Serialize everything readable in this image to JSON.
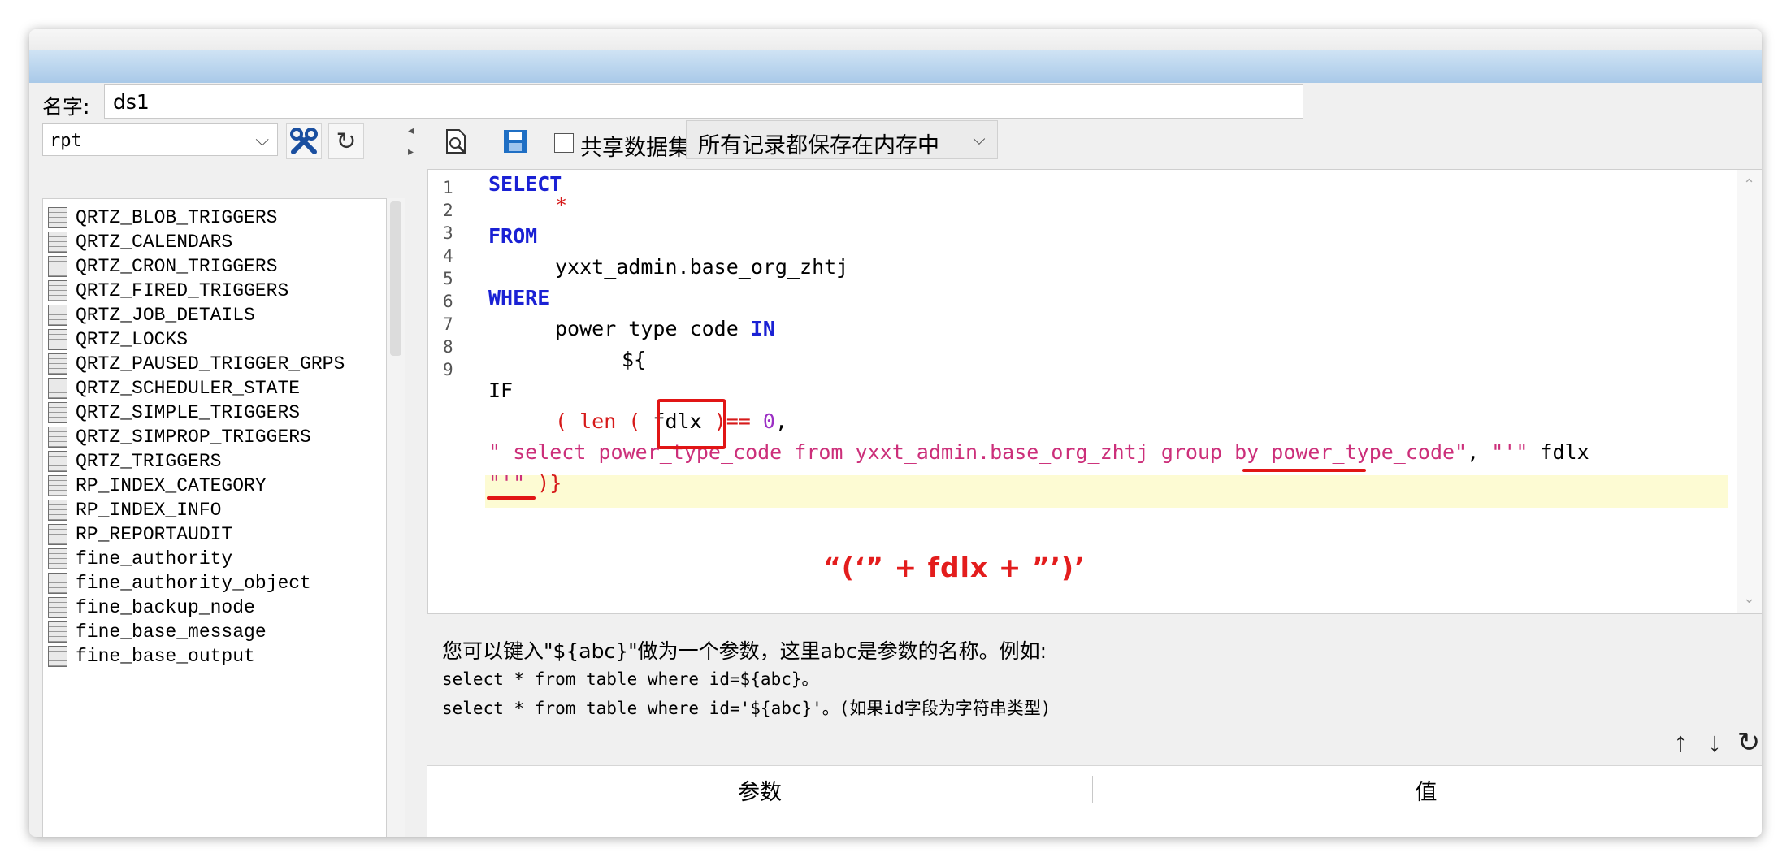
{
  "dataset": {
    "name_label": "名字:",
    "name_value": "ds1"
  },
  "db_select": {
    "value": "rpt"
  },
  "tables": [
    "QRTZ_BLOB_TRIGGERS",
    "QRTZ_CALENDARS",
    "QRTZ_CRON_TRIGGERS",
    "QRTZ_FIRED_TRIGGERS",
    "QRTZ_JOB_DETAILS",
    "QRTZ_LOCKS",
    "QRTZ_PAUSED_TRIGGER_GRPS",
    "QRTZ_SCHEDULER_STATE",
    "QRTZ_SIMPLE_TRIGGERS",
    "QRTZ_SIMPROP_TRIGGERS",
    "QRTZ_TRIGGERS",
    "RP_INDEX_CATEGORY",
    "RP_INDEX_INFO",
    "RP_REPORTAUDIT",
    "fine_authority",
    "fine_authority_object",
    "fine_backup_node",
    "fine_base_message",
    "fine_base_output"
  ],
  "toolbar": {
    "share_label": "共享数据集",
    "cache_mode": "所有记录都保存在内存中"
  },
  "editor": {
    "line_numbers": [
      "1",
      "2",
      "3",
      "4",
      "5",
      "6",
      "7",
      "8",
      "9"
    ],
    "select_kw": "SELECT",
    "star": "*",
    "from_kw": "FROM",
    "table_name": "yxxt_admin.base_org_zhtj",
    "where_kw": "WHERE",
    "col": "power_type_code",
    "in_kw": "IN",
    "param_open": "${",
    "if_kw": "IF",
    "len_prefix": "( len (",
    "fdlx": "fdlx",
    "eq_zero_a": ")== ",
    "zero": "0",
    "comma": ",",
    "subquery": "\" select power_type_code from yxxt_admin.base_org_zhtj group by power_type_code\"",
    "sep": ", ",
    "quote_open": "\"'\"",
    "fdlx2": "fdlx",
    "quote_close": "\"'\"",
    "close": ")}"
  },
  "annotation": "“(‘” + fdlx + ”’)’",
  "help": {
    "line1": "您可以键入\"${abc}\"做为一个参数，这里abc是参数的名称。例如:",
    "line2": "select * from table where id=${abc}。",
    "line3": "select * from table where id='${abc}'。(如果id字段为字符串类型)"
  },
  "param_table": {
    "col_param": "参数",
    "col_value": "值"
  },
  "colors": {
    "keyword": "#1a21d4",
    "string": "#d61a1a",
    "highlight": "#fdfbd3",
    "annotation": "#e31d1d"
  }
}
